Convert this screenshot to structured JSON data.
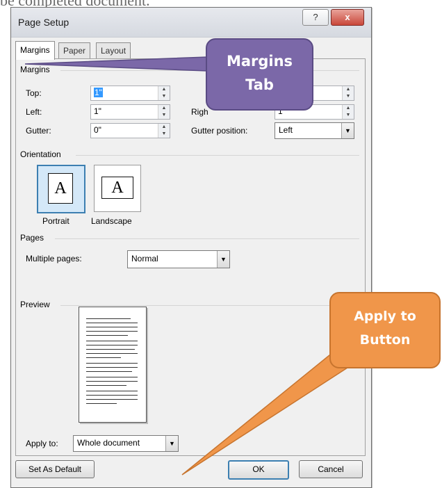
{
  "background": {
    "partial_text": "be completed document."
  },
  "dialog": {
    "title": "Page Setup",
    "help_label": "?",
    "close_label": "x",
    "tabs": [
      {
        "label": "Margins",
        "active": true
      },
      {
        "label": "Paper",
        "active": false
      },
      {
        "label": "Layout",
        "active": false
      }
    ],
    "margins": {
      "group_label": "Margins",
      "top": {
        "label": "Top:",
        "value": "1\""
      },
      "left": {
        "label": "Left:",
        "value": "1\""
      },
      "gutter": {
        "label": "Gutter:",
        "value": "0\""
      },
      "right": {
        "label": "Right:",
        "value": "1\""
      },
      "gutter_position": {
        "label": "Gutter position:",
        "value": "Left"
      }
    },
    "orientation": {
      "group_label": "Orientation",
      "portrait": {
        "label": "Portrait",
        "glyph": "A"
      },
      "landscape": {
        "label": "Landscape",
        "glyph": "A"
      }
    },
    "pages": {
      "group_label": "Pages",
      "multiple_pages": {
        "label": "Multiple pages:",
        "value": "Normal"
      }
    },
    "preview": {
      "group_label": "Preview",
      "apply_to": {
        "label": "Apply to:",
        "value": "Whole document"
      }
    },
    "buttons": {
      "set_default": "Set As Default",
      "ok": "OK",
      "cancel": "Cancel"
    }
  },
  "callouts": {
    "margins_tab": [
      "Margins",
      "Tab"
    ],
    "apply_to_button": [
      "Apply to",
      "Button"
    ]
  },
  "colors": {
    "callout_purple": "#7b68a8",
    "callout_orange": "#f0964a",
    "selection_blue": "#3399ff"
  }
}
